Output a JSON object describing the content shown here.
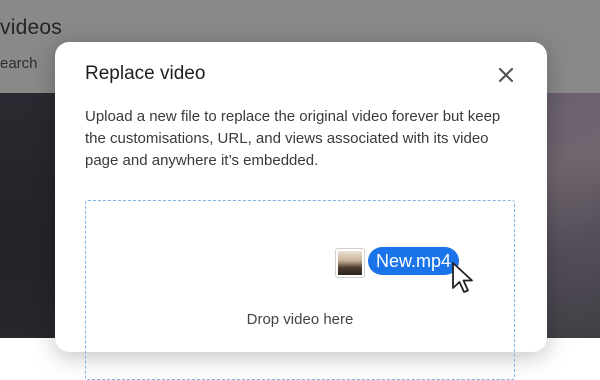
{
  "background": {
    "title": "videos",
    "search_label": "earch"
  },
  "modal": {
    "title": "Replace video",
    "close_icon": "close-icon",
    "description": "Upload a new file to replace the original video forever but keep the customisations, URL, and views associated with its video page and anywhere it’s embedded.",
    "dropzone": {
      "label": "Drop video here",
      "dragged_file": {
        "name": "New.mp4",
        "thumbnail": "file-thumbnail"
      },
      "cursor_icon": "arrow-cursor-icon"
    }
  },
  "colors": {
    "accent": "#1a73e8",
    "dropzone_border": "#7fb3e8",
    "scrim": "rgba(40,40,40,0.55)"
  }
}
